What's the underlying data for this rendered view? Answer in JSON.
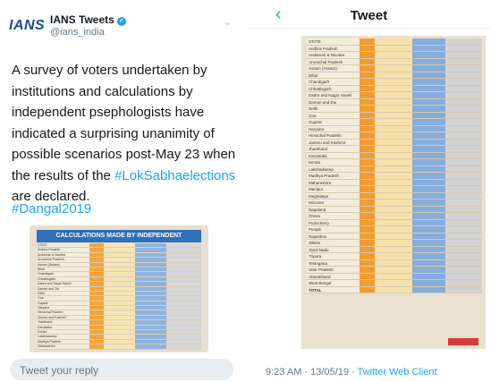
{
  "left": {
    "logo": "IANS",
    "account_name": "IANS Tweets",
    "handle": "@ians_india",
    "text_before": "A survey of voters undertaken by institutions and calculations by independent psephologists have indicated a surprising unanimity of possible scenarios post-May 23 when the results of the ",
    "hashtag1": "#LokSabhaelections",
    "text_after": " are declared.",
    "hashtag2": "#Dangal2019",
    "image_title": "CALCULATIONS MADE BY INDEPENDENT PSEPHOLOGIST I",
    "reply_placeholder": "Tweet your reply"
  },
  "right": {
    "title": "Tweet",
    "timestamp": "9:23 AM · 13/05/19 · ",
    "client": "Twitter Web Client"
  },
  "table_rows": [
    "STATE",
    "Andhra Pradesh",
    "Andaman & Nicobar",
    "Arunachal Pradesh",
    "Assam (Assam)",
    "Bihar",
    "Chandigarh",
    "Chhattisgarh",
    "Dadra and Nagar Haveli",
    "Daman and Diu",
    "Delhi",
    "Goa",
    "Gujarat",
    "Haryana",
    "Himachal Pradesh",
    "Jammu and Kashmir",
    "Jharkhand",
    "Karnataka",
    "Kerala",
    "Lakshadweep",
    "Madhya Pradesh",
    "Maharashtra",
    "Manipur",
    "Meghalaya",
    "Mizoram",
    "Nagaland",
    "Orissa",
    "Puducherry",
    "Punjab",
    "Rajasthan",
    "Sikkim",
    "Tamil Nadu",
    "Tripura",
    "Telangana",
    "Uttar Pradesh",
    "Uttarakhand",
    "West Bengal",
    "TOTAL"
  ],
  "colors": {
    "accent": "#1da1f2",
    "bjp": "#f39b30",
    "congress": "#86acdc",
    "others": "#d3d3d3"
  }
}
